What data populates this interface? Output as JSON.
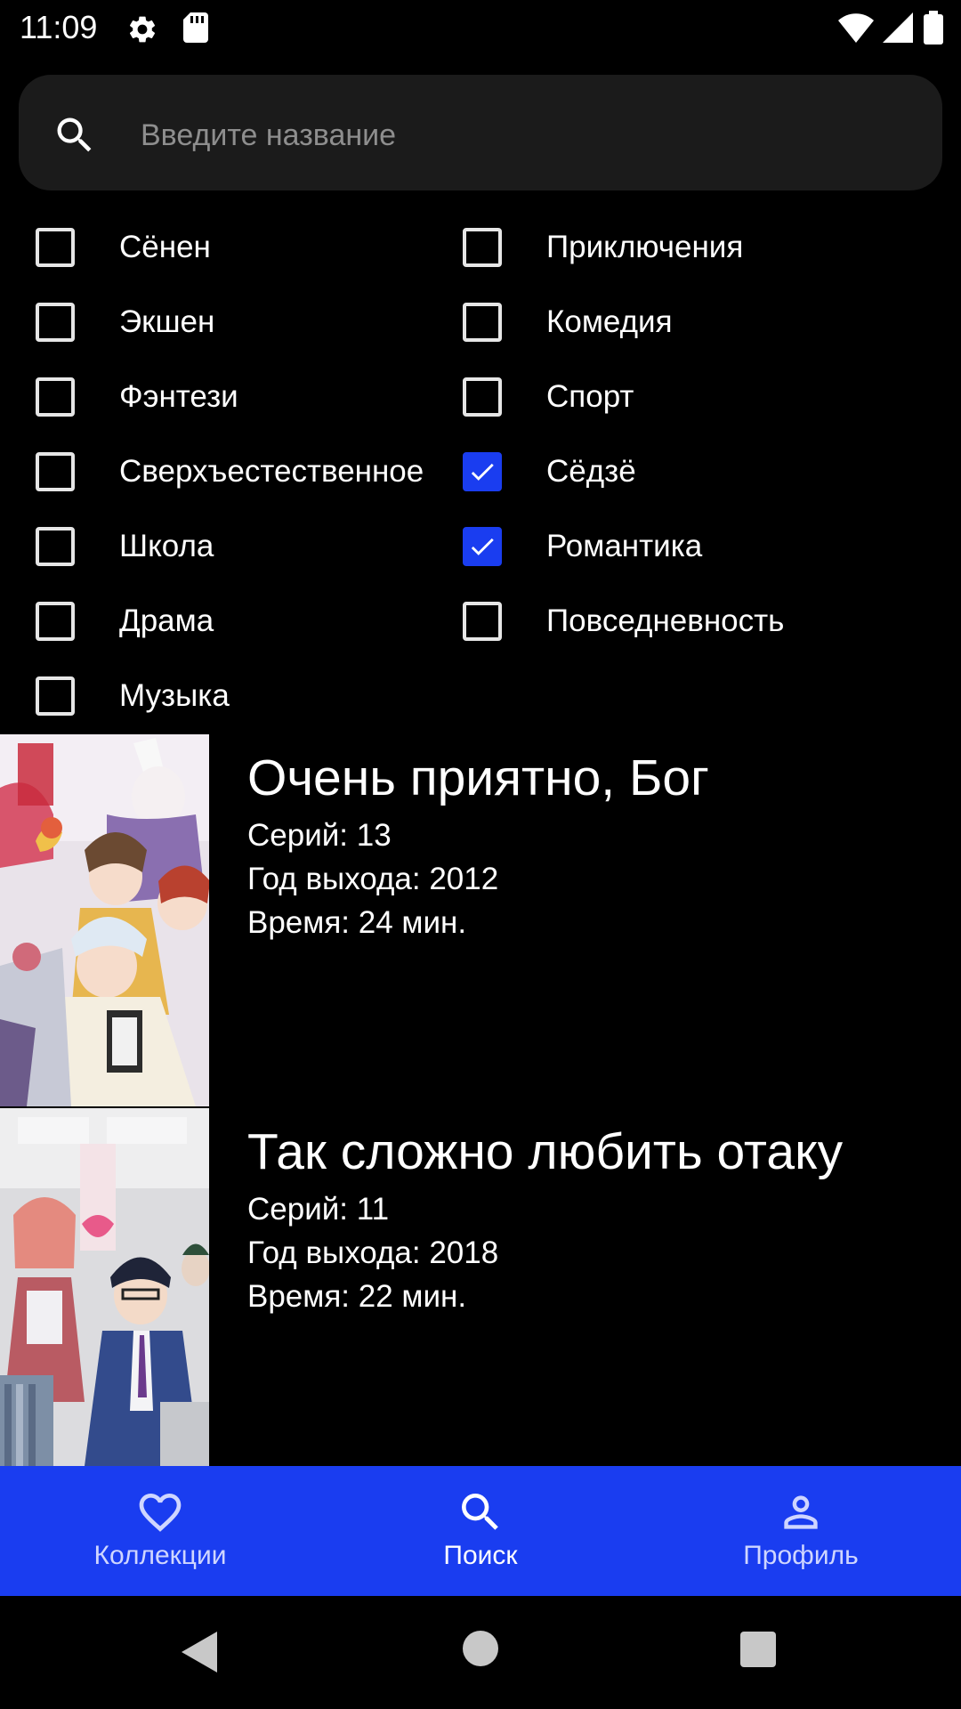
{
  "status_bar": {
    "time": "11:09",
    "icons": [
      "gear-icon",
      "sd-card-icon",
      "wifi-icon",
      "cell-signal-icon",
      "battery-icon"
    ]
  },
  "search": {
    "placeholder": "Введите название",
    "value": ""
  },
  "genres": {
    "left": [
      {
        "label": "Сёнен",
        "checked": false
      },
      {
        "label": "Экшен",
        "checked": false
      },
      {
        "label": "Фэнтези",
        "checked": false
      },
      {
        "label": "Сверхъестественное",
        "checked": false
      },
      {
        "label": "Школа",
        "checked": false
      },
      {
        "label": "Драма",
        "checked": false
      },
      {
        "label": "Музыка",
        "checked": false
      }
    ],
    "right": [
      {
        "label": "Приключения",
        "checked": false
      },
      {
        "label": "Комедия",
        "checked": false
      },
      {
        "label": "Спорт",
        "checked": false
      },
      {
        "label": "Сёдзё",
        "checked": true
      },
      {
        "label": "Романтика",
        "checked": true
      },
      {
        "label": "Повседневность",
        "checked": false
      }
    ]
  },
  "results": [
    {
      "title": "Очень приятно, Бог",
      "episodes": "Серий: 13",
      "year": "Год выхода: 2012",
      "duration": "Время: 24 мин."
    },
    {
      "title": "Так сложно любить отаку",
      "episodes": "Серий: 11",
      "year": "Год выхода: 2018",
      "duration": "Время: 22 мин."
    }
  ],
  "bottom_nav": {
    "items": [
      {
        "label": "Коллекции",
        "icon": "heart-icon"
      },
      {
        "label": "Поиск",
        "icon": "search-icon",
        "active": true
      },
      {
        "label": "Профиль",
        "icon": "person-icon"
      }
    ]
  },
  "colors": {
    "accent": "#1a3df0",
    "background": "#000000",
    "search_field": "#1b1b1b"
  }
}
